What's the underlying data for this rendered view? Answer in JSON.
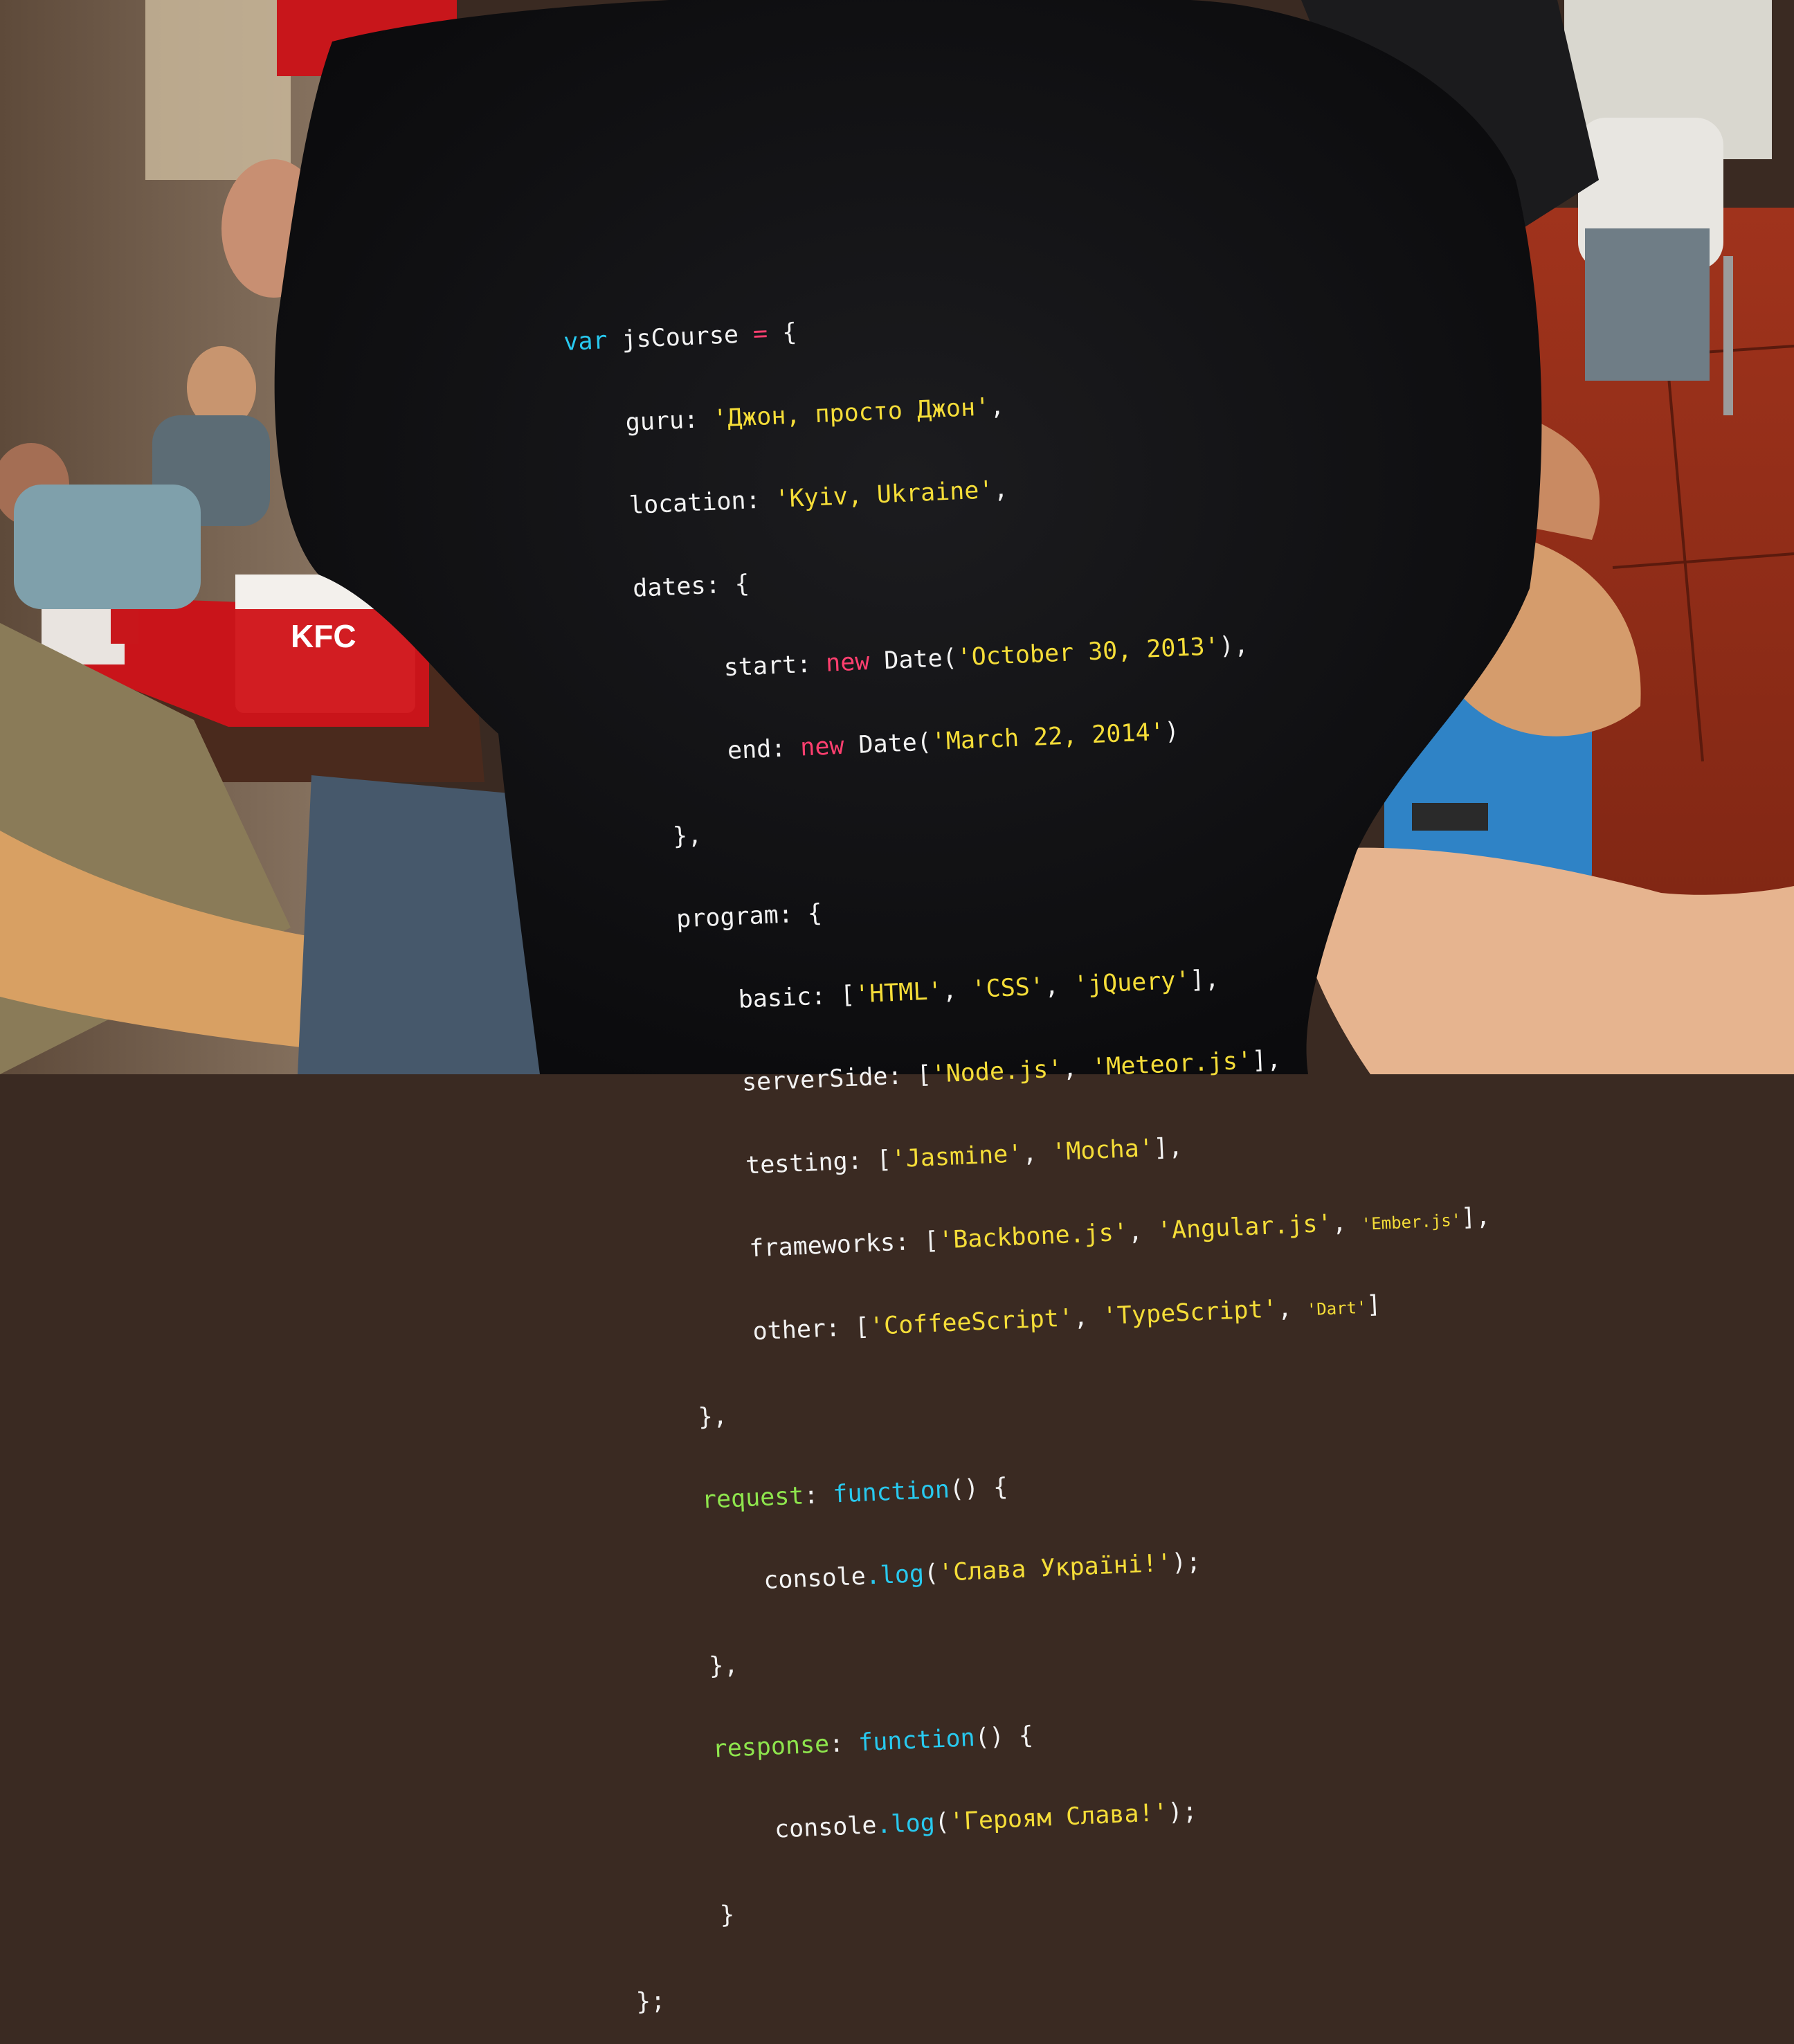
{
  "code": {
    "l1_var": "var",
    "l1_name": " jsCourse ",
    "l1_eq": "=",
    "l1_brace": " {",
    "l2_key": "guru: ",
    "l2_val": "'Джон, просто Джон'",
    "l2_end": ",",
    "l3_key": "location: ",
    "l3_val": "'Kyiv, Ukraine'",
    "l3_end": ",",
    "l4_key": "dates: {",
    "l5_key": "start: ",
    "l5_new": "new",
    "l5_date": " Date(",
    "l5_val": "'October 30, 2013'",
    "l5_end": "),",
    "l6_key": "end: ",
    "l6_new": "new",
    "l6_date": " Date(",
    "l6_val": "'March 22, 2014'",
    "l6_end": ")",
    "l7": "},",
    "l8_key": "program: {",
    "l9_key": "basic: [",
    "l9_v1": "'HTML'",
    "l9_s1": ", ",
    "l9_v2": "'CSS'",
    "l9_s2": ", ",
    "l9_v3": "'jQuery'",
    "l9_end": "],",
    "l10_key": "serverSide: [",
    "l10_v1": "'Node.js'",
    "l10_s1": ", ",
    "l10_v2": "'Meteor.js'",
    "l10_end": "],",
    "l11_key": "testing: [",
    "l11_v1": "'Jasmine'",
    "l11_s1": ", ",
    "l11_v2": "'Mocha'",
    "l11_end": "],",
    "l12_key": "frameworks: [",
    "l12_v1": "'Backbone.js'",
    "l12_s1": ", ",
    "l12_v2": "'Angular.js'",
    "l12_s2": ", ",
    "l12_v3": "'Ember.js'",
    "l12_end": "],",
    "l13_key": "other: [",
    "l13_v1": "'CoffeeScript'",
    "l13_s1": ", ",
    "l13_v2": "'TypeScript'",
    "l13_s2": ", ",
    "l13_v3": "'Dart'",
    "l13_end": "]",
    "l14": "},",
    "l15_key": "request",
    "l15_colon": ": ",
    "l15_fn": "function",
    "l15_end": "() {",
    "l16_obj": "console",
    "l16_dot": ".",
    "l16_log": "log",
    "l16_open": "(",
    "l16_val": "'Слава Україні!'",
    "l16_end": ");",
    "l17": "},",
    "l18_key": "response",
    "l18_colon": ": ",
    "l18_fn": "function",
    "l18_end": "() {",
    "l19_obj": "console",
    "l19_dot": ".",
    "l19_log": "log",
    "l19_open": "(",
    "l19_val": "'Героям Слава!'",
    "l19_end": ");",
    "l20": "}",
    "l21": "};"
  },
  "background": {
    "tray_cup_text": "KFC"
  },
  "colors": {
    "keyword": "#ff3f6f",
    "string": "#f5dd38",
    "function": "#28c9ef",
    "property": "#8ee54d",
    "text": "#f2f2f2",
    "shirt": "#141416"
  }
}
